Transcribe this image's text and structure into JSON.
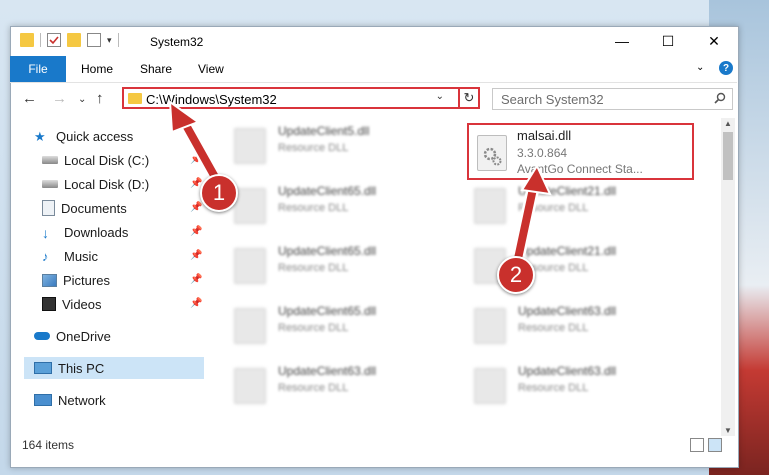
{
  "window": {
    "title": "System32",
    "minimize_glyph": "—",
    "maximize_glyph": "☐",
    "close_glyph": "✕"
  },
  "ribbon": {
    "tabs": [
      "File",
      "Home",
      "Share",
      "View"
    ],
    "help_glyph": "?"
  },
  "address": {
    "path": "C:\\Windows\\System32",
    "refresh_glyph": "↻",
    "dropdown_glyph": "⌄"
  },
  "search": {
    "placeholder": "Search System32",
    "icon": "search-icon"
  },
  "nav_pane": {
    "items": [
      {
        "label": "Quick access",
        "icon": "star-icon",
        "pinned": false
      },
      {
        "label": "Local Disk (C:)",
        "icon": "drive-icon",
        "pinned": true
      },
      {
        "label": "Local Disk (D:)",
        "icon": "drive-icon",
        "pinned": true
      },
      {
        "label": "Documents",
        "icon": "documents-icon",
        "pinned": true
      },
      {
        "label": "Downloads",
        "icon": "downloads-icon",
        "pinned": true
      },
      {
        "label": "Music",
        "icon": "music-icon",
        "pinned": true
      },
      {
        "label": "Pictures",
        "icon": "pictures-icon",
        "pinned": true
      },
      {
        "label": "Videos",
        "icon": "videos-icon",
        "pinned": true
      },
      {
        "label": "OneDrive",
        "icon": "cloud-icon",
        "pinned": false
      },
      {
        "label": "This PC",
        "icon": "computer-icon",
        "pinned": false,
        "selected": true
      },
      {
        "label": "Network",
        "icon": "network-icon",
        "pinned": false
      }
    ]
  },
  "files": {
    "blurred": [
      {
        "name": "UpdateClient5.dll",
        "type": "Resource DLL"
      },
      {
        "name": "UpdateClient65.dll",
        "type": "Resource DLL"
      },
      {
        "name": "UpdateClient21.dll",
        "type": "Resource DLL"
      },
      {
        "name": "UpdateClient65.dll",
        "type": "Resource DLL"
      },
      {
        "name": "UpdateClient21.dll",
        "type": "Resource DLL"
      },
      {
        "name": "UpdateClient65.dll",
        "type": "Resource DLL"
      },
      {
        "name": "UpdateClient63.dll",
        "type": "Resource DLL"
      },
      {
        "name": "UpdateClient63.dll",
        "type": "Resource DLL"
      },
      {
        "name": "UpdateClient63.dll",
        "type": "Resource DLL"
      }
    ],
    "highlighted": {
      "name": "malsai.dll",
      "version": "3.3.0.864",
      "description": "AvantGo Connect Sta..."
    }
  },
  "annotations": {
    "step1": "1",
    "step2": "2"
  },
  "status": {
    "item_count": "164 items"
  },
  "colors": {
    "accent": "#1979ca",
    "highlight_border": "#d9343b",
    "badge": "#c9302c",
    "selection": "#cce4f7"
  }
}
